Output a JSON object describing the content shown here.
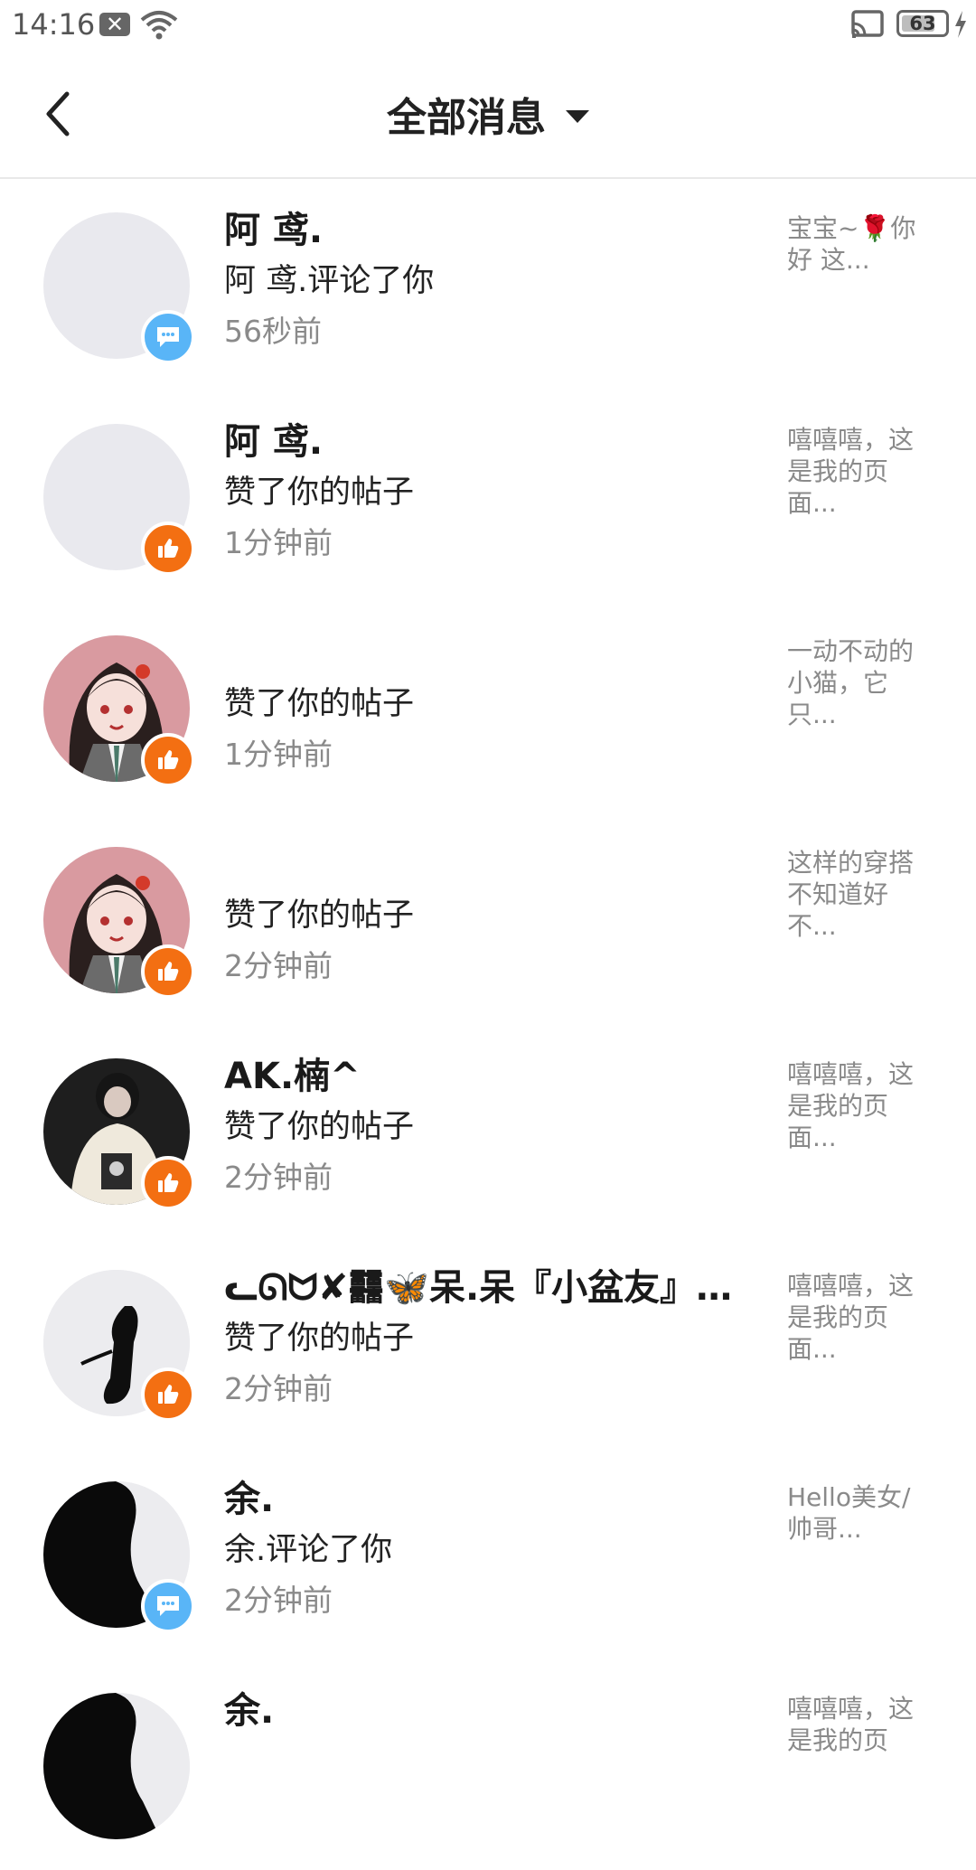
{
  "status_bar": {
    "time": "14:16",
    "battery": "63"
  },
  "header": {
    "title": "全部消息"
  },
  "messages": [
    {
      "name": "阿 鸢.",
      "action": "阿 鸢.评论了你",
      "time": "56秒前",
      "preview": "宝宝~🌹你好 这...",
      "badge": "comment",
      "avatar": "blank"
    },
    {
      "name": "阿 鸢.",
      "action": "赞了你的帖子",
      "time": "1分钟前",
      "preview": "嘻嘻嘻，这是我的页面...",
      "badge": "like",
      "avatar": "blank"
    },
    {
      "name": "",
      "action": "赞了你的帖子",
      "time": "1分钟前",
      "preview": "一动不动的小猫，它只...",
      "badge": "like",
      "avatar": "anime-girl"
    },
    {
      "name": "",
      "action": "赞了你的帖子",
      "time": "2分钟前",
      "preview": "这样的穿搭不知道好不...",
      "badge": "like",
      "avatar": "anime-girl"
    },
    {
      "name": "AK.楠^",
      "action": "赞了你的帖子",
      "time": "2分钟前",
      "preview": "嘻嘻嘻，这是我的页面...",
      "badge": "like",
      "avatar": "photo-girl"
    },
    {
      "name": "ᓚᘏᗢ✘䨻🦋呆.呆『小盆友』囍...",
      "action": "赞了你的帖子",
      "time": "2分钟前",
      "preview": "嘻嘻嘻，这是我的页面...",
      "badge": "like",
      "avatar": "silhouette"
    },
    {
      "name": "余.",
      "action": "余.评论了你",
      "time": "2分钟前",
      "preview": "Hello美女/帅哥...",
      "badge": "comment",
      "avatar": "silhouette-dark"
    },
    {
      "name": "余.",
      "action": "",
      "time": "",
      "preview": "嘻嘻嘻，这是我的页",
      "badge": "",
      "avatar": "silhouette-dark"
    }
  ],
  "colors": {
    "like_badge": "#f36f12",
    "comment_badge": "#59b5f7",
    "secondary_text": "#8a8a8a"
  }
}
